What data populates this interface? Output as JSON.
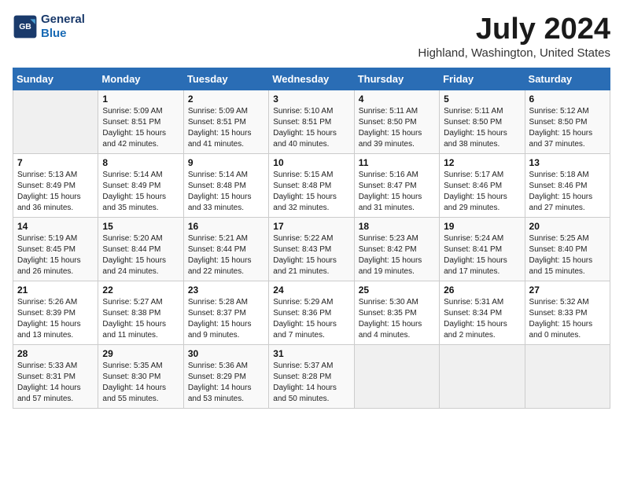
{
  "header": {
    "logo_line1": "General",
    "logo_line2": "Blue",
    "title": "July 2024",
    "subtitle": "Highland, Washington, United States"
  },
  "calendar": {
    "days_of_week": [
      "Sunday",
      "Monday",
      "Tuesday",
      "Wednesday",
      "Thursday",
      "Friday",
      "Saturday"
    ],
    "weeks": [
      [
        {
          "day": "",
          "info": ""
        },
        {
          "day": "1",
          "info": "Sunrise: 5:09 AM\nSunset: 8:51 PM\nDaylight: 15 hours\nand 42 minutes."
        },
        {
          "day": "2",
          "info": "Sunrise: 5:09 AM\nSunset: 8:51 PM\nDaylight: 15 hours\nand 41 minutes."
        },
        {
          "day": "3",
          "info": "Sunrise: 5:10 AM\nSunset: 8:51 PM\nDaylight: 15 hours\nand 40 minutes."
        },
        {
          "day": "4",
          "info": "Sunrise: 5:11 AM\nSunset: 8:50 PM\nDaylight: 15 hours\nand 39 minutes."
        },
        {
          "day": "5",
          "info": "Sunrise: 5:11 AM\nSunset: 8:50 PM\nDaylight: 15 hours\nand 38 minutes."
        },
        {
          "day": "6",
          "info": "Sunrise: 5:12 AM\nSunset: 8:50 PM\nDaylight: 15 hours\nand 37 minutes."
        }
      ],
      [
        {
          "day": "7",
          "info": "Sunrise: 5:13 AM\nSunset: 8:49 PM\nDaylight: 15 hours\nand 36 minutes."
        },
        {
          "day": "8",
          "info": "Sunrise: 5:14 AM\nSunset: 8:49 PM\nDaylight: 15 hours\nand 35 minutes."
        },
        {
          "day": "9",
          "info": "Sunrise: 5:14 AM\nSunset: 8:48 PM\nDaylight: 15 hours\nand 33 minutes."
        },
        {
          "day": "10",
          "info": "Sunrise: 5:15 AM\nSunset: 8:48 PM\nDaylight: 15 hours\nand 32 minutes."
        },
        {
          "day": "11",
          "info": "Sunrise: 5:16 AM\nSunset: 8:47 PM\nDaylight: 15 hours\nand 31 minutes."
        },
        {
          "day": "12",
          "info": "Sunrise: 5:17 AM\nSunset: 8:46 PM\nDaylight: 15 hours\nand 29 minutes."
        },
        {
          "day": "13",
          "info": "Sunrise: 5:18 AM\nSunset: 8:46 PM\nDaylight: 15 hours\nand 27 minutes."
        }
      ],
      [
        {
          "day": "14",
          "info": "Sunrise: 5:19 AM\nSunset: 8:45 PM\nDaylight: 15 hours\nand 26 minutes."
        },
        {
          "day": "15",
          "info": "Sunrise: 5:20 AM\nSunset: 8:44 PM\nDaylight: 15 hours\nand 24 minutes."
        },
        {
          "day": "16",
          "info": "Sunrise: 5:21 AM\nSunset: 8:44 PM\nDaylight: 15 hours\nand 22 minutes."
        },
        {
          "day": "17",
          "info": "Sunrise: 5:22 AM\nSunset: 8:43 PM\nDaylight: 15 hours\nand 21 minutes."
        },
        {
          "day": "18",
          "info": "Sunrise: 5:23 AM\nSunset: 8:42 PM\nDaylight: 15 hours\nand 19 minutes."
        },
        {
          "day": "19",
          "info": "Sunrise: 5:24 AM\nSunset: 8:41 PM\nDaylight: 15 hours\nand 17 minutes."
        },
        {
          "day": "20",
          "info": "Sunrise: 5:25 AM\nSunset: 8:40 PM\nDaylight: 15 hours\nand 15 minutes."
        }
      ],
      [
        {
          "day": "21",
          "info": "Sunrise: 5:26 AM\nSunset: 8:39 PM\nDaylight: 15 hours\nand 13 minutes."
        },
        {
          "day": "22",
          "info": "Sunrise: 5:27 AM\nSunset: 8:38 PM\nDaylight: 15 hours\nand 11 minutes."
        },
        {
          "day": "23",
          "info": "Sunrise: 5:28 AM\nSunset: 8:37 PM\nDaylight: 15 hours\nand 9 minutes."
        },
        {
          "day": "24",
          "info": "Sunrise: 5:29 AM\nSunset: 8:36 PM\nDaylight: 15 hours\nand 7 minutes."
        },
        {
          "day": "25",
          "info": "Sunrise: 5:30 AM\nSunset: 8:35 PM\nDaylight: 15 hours\nand 4 minutes."
        },
        {
          "day": "26",
          "info": "Sunrise: 5:31 AM\nSunset: 8:34 PM\nDaylight: 15 hours\nand 2 minutes."
        },
        {
          "day": "27",
          "info": "Sunrise: 5:32 AM\nSunset: 8:33 PM\nDaylight: 15 hours\nand 0 minutes."
        }
      ],
      [
        {
          "day": "28",
          "info": "Sunrise: 5:33 AM\nSunset: 8:31 PM\nDaylight: 14 hours\nand 57 minutes."
        },
        {
          "day": "29",
          "info": "Sunrise: 5:35 AM\nSunset: 8:30 PM\nDaylight: 14 hours\nand 55 minutes."
        },
        {
          "day": "30",
          "info": "Sunrise: 5:36 AM\nSunset: 8:29 PM\nDaylight: 14 hours\nand 53 minutes."
        },
        {
          "day": "31",
          "info": "Sunrise: 5:37 AM\nSunset: 8:28 PM\nDaylight: 14 hours\nand 50 minutes."
        },
        {
          "day": "",
          "info": ""
        },
        {
          "day": "",
          "info": ""
        },
        {
          "day": "",
          "info": ""
        }
      ]
    ]
  }
}
